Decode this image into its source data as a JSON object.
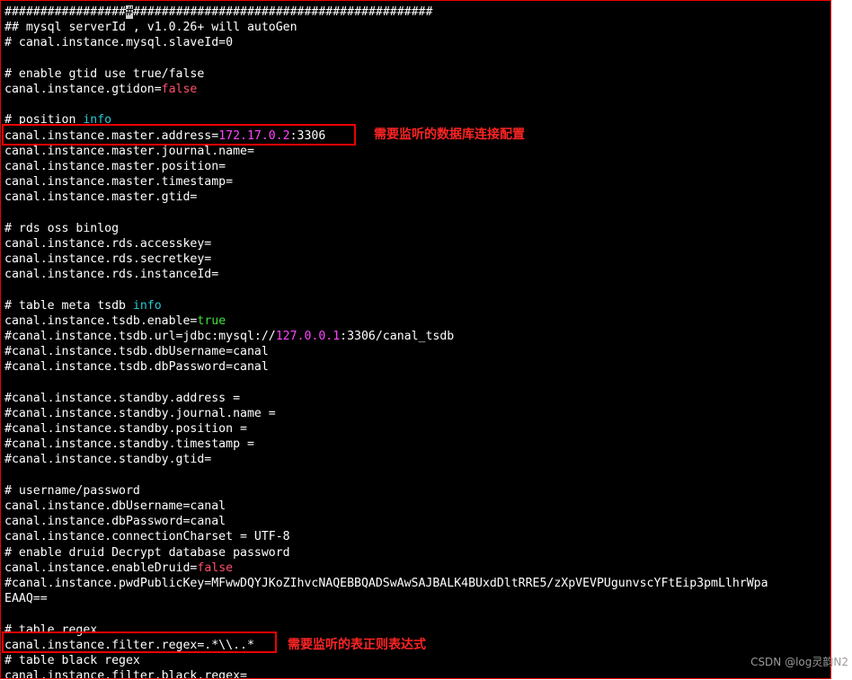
{
  "terminal": {
    "lines": [
      [
        {
          "t": "#################",
          "c": "default"
        },
        {
          "t": "#",
          "c": "cursor"
        },
        {
          "t": "##########################################",
          "c": "default"
        }
      ],
      [
        {
          "t": "## mysql serverId , v1.0.26+ will autoGen",
          "c": "default"
        }
      ],
      [
        {
          "t": "# canal.instance.mysql.slaveId=0",
          "c": "default"
        }
      ],
      [
        {
          "t": "",
          "c": "default"
        }
      ],
      [
        {
          "t": "# enable gtid use true/false",
          "c": "default"
        }
      ],
      [
        {
          "t": "canal.instance.gtidon=",
          "c": "default"
        },
        {
          "t": "false",
          "c": "red"
        }
      ],
      [
        {
          "t": "",
          "c": "default"
        }
      ],
      [
        {
          "t": "# position ",
          "c": "default"
        },
        {
          "t": "info",
          "c": "cyan"
        }
      ],
      [
        {
          "t": "canal.instance.master.address=",
          "c": "default"
        },
        {
          "t": "172.17.0.2",
          "c": "magenta"
        },
        {
          "t": ":3306",
          "c": "default"
        }
      ],
      [
        {
          "t": "canal.instance.master.journal.name=",
          "c": "default"
        }
      ],
      [
        {
          "t": "canal.instance.master.position=",
          "c": "default"
        }
      ],
      [
        {
          "t": "canal.instance.master.timestamp=",
          "c": "default"
        }
      ],
      [
        {
          "t": "canal.instance.master.gtid=",
          "c": "default"
        }
      ],
      [
        {
          "t": "",
          "c": "default"
        }
      ],
      [
        {
          "t": "# rds oss binlog",
          "c": "default"
        }
      ],
      [
        {
          "t": "canal.instance.rds.accesskey=",
          "c": "default"
        }
      ],
      [
        {
          "t": "canal.instance.rds.secretkey=",
          "c": "default"
        }
      ],
      [
        {
          "t": "canal.instance.rds.instanceId=",
          "c": "default"
        }
      ],
      [
        {
          "t": "",
          "c": "default"
        }
      ],
      [
        {
          "t": "# table meta tsdb ",
          "c": "default"
        },
        {
          "t": "info",
          "c": "cyan"
        }
      ],
      [
        {
          "t": "canal.instance.tsdb.enable=",
          "c": "default"
        },
        {
          "t": "true",
          "c": "green"
        }
      ],
      [
        {
          "t": "#canal.instance.tsdb.url=jdbc:mysql://",
          "c": "default"
        },
        {
          "t": "127.0.0.1",
          "c": "magenta"
        },
        {
          "t": ":3306/canal_tsdb",
          "c": "default"
        }
      ],
      [
        {
          "t": "#canal.instance.tsdb.dbUsername=canal",
          "c": "default"
        }
      ],
      [
        {
          "t": "#canal.instance.tsdb.dbPassword=canal",
          "c": "default"
        }
      ],
      [
        {
          "t": "",
          "c": "default"
        }
      ],
      [
        {
          "t": "#canal.instance.standby.address =",
          "c": "default"
        }
      ],
      [
        {
          "t": "#canal.instance.standby.journal.name =",
          "c": "default"
        }
      ],
      [
        {
          "t": "#canal.instance.standby.position =",
          "c": "default"
        }
      ],
      [
        {
          "t": "#canal.instance.standby.timestamp =",
          "c": "default"
        }
      ],
      [
        {
          "t": "#canal.instance.standby.gtid=",
          "c": "default"
        }
      ],
      [
        {
          "t": "",
          "c": "default"
        }
      ],
      [
        {
          "t": "# username/password",
          "c": "default"
        }
      ],
      [
        {
          "t": "canal.instance.dbUsername=canal",
          "c": "default"
        }
      ],
      [
        {
          "t": "canal.instance.dbPassword=canal",
          "c": "default"
        }
      ],
      [
        {
          "t": "canal.instance.connectionCharset = UTF-8",
          "c": "default"
        }
      ],
      [
        {
          "t": "# enable druid Decrypt database password",
          "c": "default"
        }
      ],
      [
        {
          "t": "canal.instance.enableDruid=",
          "c": "default"
        },
        {
          "t": "false",
          "c": "red"
        }
      ],
      [
        {
          "t": "#canal.instance.pwdPublicKey=MFwwDQYJKoZIhvcNAQEBBQADSwAwSAJBALK4BUxdDltRRE5/zXpVEVPUgunvscYFtEip3pmLlhrWpa",
          "c": "default"
        }
      ],
      [
        {
          "t": "EAAQ==",
          "c": "default"
        }
      ],
      [
        {
          "t": "",
          "c": "default"
        }
      ],
      [
        {
          "t": "# table regex",
          "c": "default"
        }
      ],
      [
        {
          "t": "canal.instance.filter.regex=.*\\\\..*",
          "c": "default"
        }
      ],
      [
        {
          "t": "# table black regex",
          "c": "default"
        }
      ],
      [
        {
          "t": "canal.instance.filter.black.regex=",
          "c": "default"
        }
      ]
    ]
  },
  "annotations": {
    "db_config": "需要监听的数据库连接配置",
    "regex": "需要监听的表正则表达式"
  },
  "watermark": "CSDN @log灵韵N2",
  "colors": {
    "background": "#000000",
    "text": "#ffffff",
    "keyword_cyan": "#2ac9d6",
    "boolean_false": "#ff4f6b",
    "boolean_true": "#3fe03f",
    "ip_address": "#ff44ff",
    "annotation_red": "#ff2424"
  }
}
